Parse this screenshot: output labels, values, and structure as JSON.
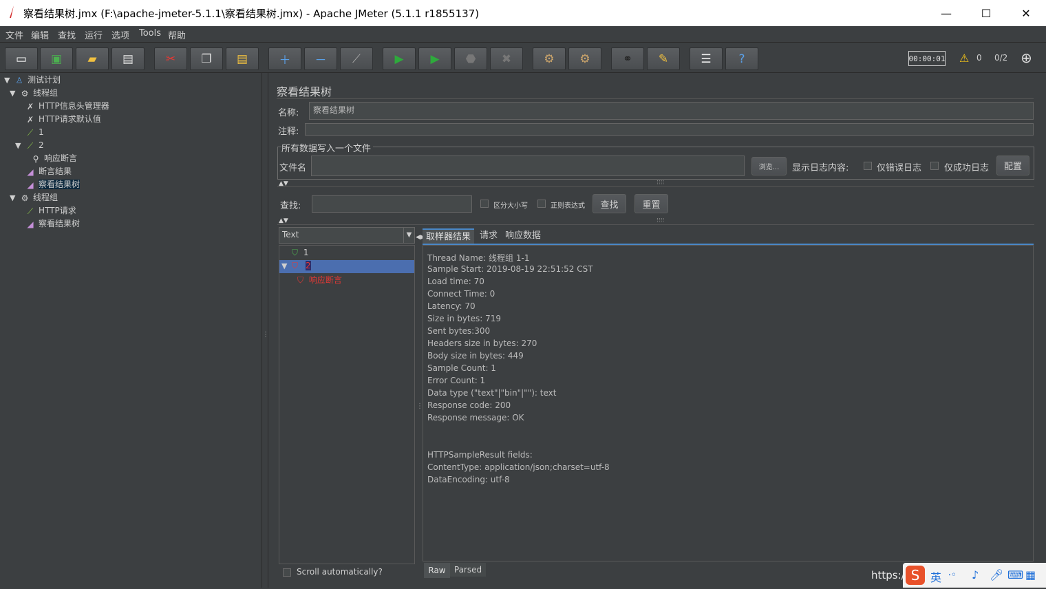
{
  "window": {
    "title": "察看结果树.jmx (F:\\apache-jmeter-5.1.1\\察看结果树.jmx) - Apache JMeter (5.1.1 r1855137)",
    "minimize": "—",
    "maximize": "☐",
    "close": "✕"
  },
  "menu": [
    "文件",
    "编辑",
    "查找",
    "运行",
    "选项",
    "Tools",
    "帮助"
  ],
  "toolbar": {
    "timer": "00:00:01",
    "warning_count": "0",
    "threads": "0/2"
  },
  "tree": [
    {
      "label": "测试计划",
      "icon": "test-plan-icon"
    },
    {
      "label": "线程组",
      "icon": "gear-icon"
    },
    {
      "label": "HTTP信息头管理器",
      "icon": "wrench-icon"
    },
    {
      "label": "HTTP请求默认值",
      "icon": "wrench-icon"
    },
    {
      "label": "1",
      "icon": "sampler-pipette-icon"
    },
    {
      "label": "2",
      "icon": "sampler-pipette-icon"
    },
    {
      "label": "响应断言",
      "icon": "magnifier-icon"
    },
    {
      "label": "断言结果",
      "icon": "graph-icon"
    },
    {
      "label": "察看结果树",
      "icon": "graph-icon"
    },
    {
      "label": "线程组",
      "icon": "gear-icon"
    },
    {
      "label": "HTTP请求",
      "icon": "sampler-pipette-icon"
    },
    {
      "label": "察看结果树",
      "icon": "graph-icon"
    }
  ],
  "panel": {
    "heading": "察看结果树",
    "name_label": "名称:",
    "name_value": "察看结果树",
    "comment_label": "注释:",
    "comment_value": "",
    "file_section": "所有数据写入一个文件",
    "filename_label": "文件名",
    "browse": "浏览...",
    "log_label": "显示日志内容:",
    "errors_only": "仅错误日志",
    "success_only": "仅成功日志",
    "configure": "配置",
    "search_label": "查找:",
    "case_sensitive": "区分大小写",
    "regex": "正则表达式",
    "find_btn": "查找",
    "reset_btn": "重置"
  },
  "results": {
    "renderer": "Text",
    "samples": [
      {
        "label": "1",
        "status": "pass"
      },
      {
        "label": "2",
        "status": "fail"
      },
      {
        "label": "响应断言",
        "status": "fail"
      }
    ],
    "scroll_auto": "Scroll automatically?",
    "tabs": [
      "取样器结果",
      "请求",
      "响应数据"
    ],
    "bottom_tabs": [
      "Raw",
      "Parsed"
    ],
    "lines": [
      "Thread Name: 线程组 1-1",
      "Sample Start: 2019-08-19 22:51:52 CST",
      "Load time: 70",
      "Connect Time: 0",
      "Latency: 70",
      "Size in bytes: 719",
      "Sent bytes:300",
      "Headers size in bytes: 270",
      "Body size in bytes: 449",
      "Sample Count: 1",
      "Error Count: 1",
      "Data type (\"text\"|\"bin\"|\"\"): text",
      "Response code: 200",
      "Response message: OK",
      "",
      "",
      "HTTPSampleResult fields:",
      "ContentType: application/json;charset=utf-8",
      "DataEncoding: utf-8"
    ]
  },
  "watermark": "https://bl"
}
